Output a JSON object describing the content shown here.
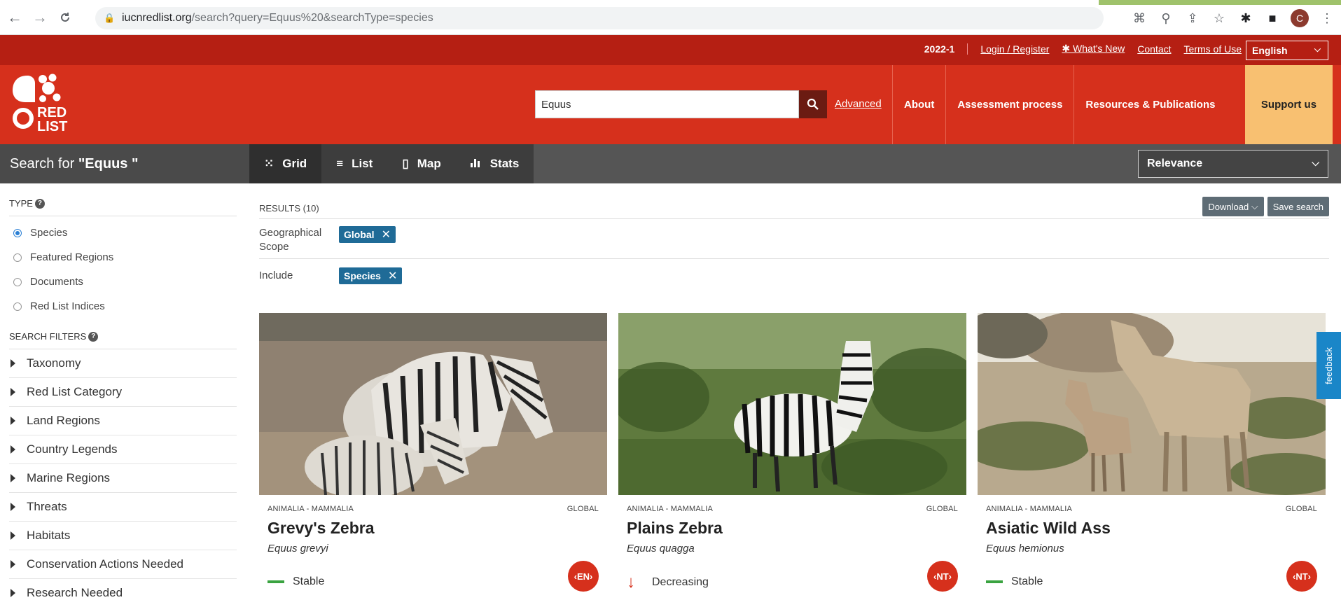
{
  "browser": {
    "url_host": "iucnredlist.org",
    "url_path": "/search?query=Equus%20&searchType=species"
  },
  "topbar": {
    "version": "2022-1",
    "login": "Login / Register",
    "whats_new": "✱ What's New",
    "contact": "Contact",
    "terms": "Terms of Use",
    "language": "English"
  },
  "header": {
    "logo_text_1": "RED",
    "logo_text_2": "LIST",
    "search_value": "Equus",
    "advanced": "Advanced",
    "nav": [
      "About",
      "Assessment process",
      "Resources & Publications"
    ],
    "support": "Support us"
  },
  "resultsbar": {
    "search_for_prefix": "Search for ",
    "search_for_query": "\"Equus \"",
    "views": [
      "Grid",
      "List",
      "Map",
      "Stats"
    ],
    "sort": "Relevance"
  },
  "sidebar": {
    "type_heading": "TYPE",
    "types": [
      "Species",
      "Featured Regions",
      "Documents",
      "Red List Indices"
    ],
    "filters_heading": "SEARCH FILTERS",
    "filters": [
      "Taxonomy",
      "Red List Category",
      "Land Regions",
      "Country Legends",
      "Marine Regions",
      "Threats",
      "Habitats",
      "Conservation Actions Needed",
      "Research Needed"
    ]
  },
  "results": {
    "count_label": "RESULTS (10)",
    "download": "Download",
    "save_search": "Save search",
    "scope_label_1": "Geographical",
    "scope_label_2": "Scope",
    "scope_chip": "Global",
    "include_label": "Include",
    "include_chip": "Species"
  },
  "cards": [
    {
      "kingdom": "ANIMALIA - MAMMALIA",
      "scope": "GLOBAL",
      "name": "Grevy's Zebra",
      "scientific": "Equus grevyi",
      "trend": "Stable",
      "status": "EN"
    },
    {
      "kingdom": "ANIMALIA - MAMMALIA",
      "scope": "GLOBAL",
      "name": "Plains Zebra",
      "scientific": "Equus quagga",
      "trend": "Decreasing",
      "status": "NT"
    },
    {
      "kingdom": "ANIMALIA - MAMMALIA",
      "scope": "GLOBAL",
      "name": "Asiatic Wild Ass",
      "scientific": "Equus hemionus",
      "trend": "Stable",
      "status": "NT"
    }
  ],
  "feedback": "feedback",
  "colors": {
    "brand_red": "#d6301c",
    "dark_red": "#b51f13",
    "support_yellow": "#f8c071",
    "chip_blue": "#1f6b97"
  }
}
